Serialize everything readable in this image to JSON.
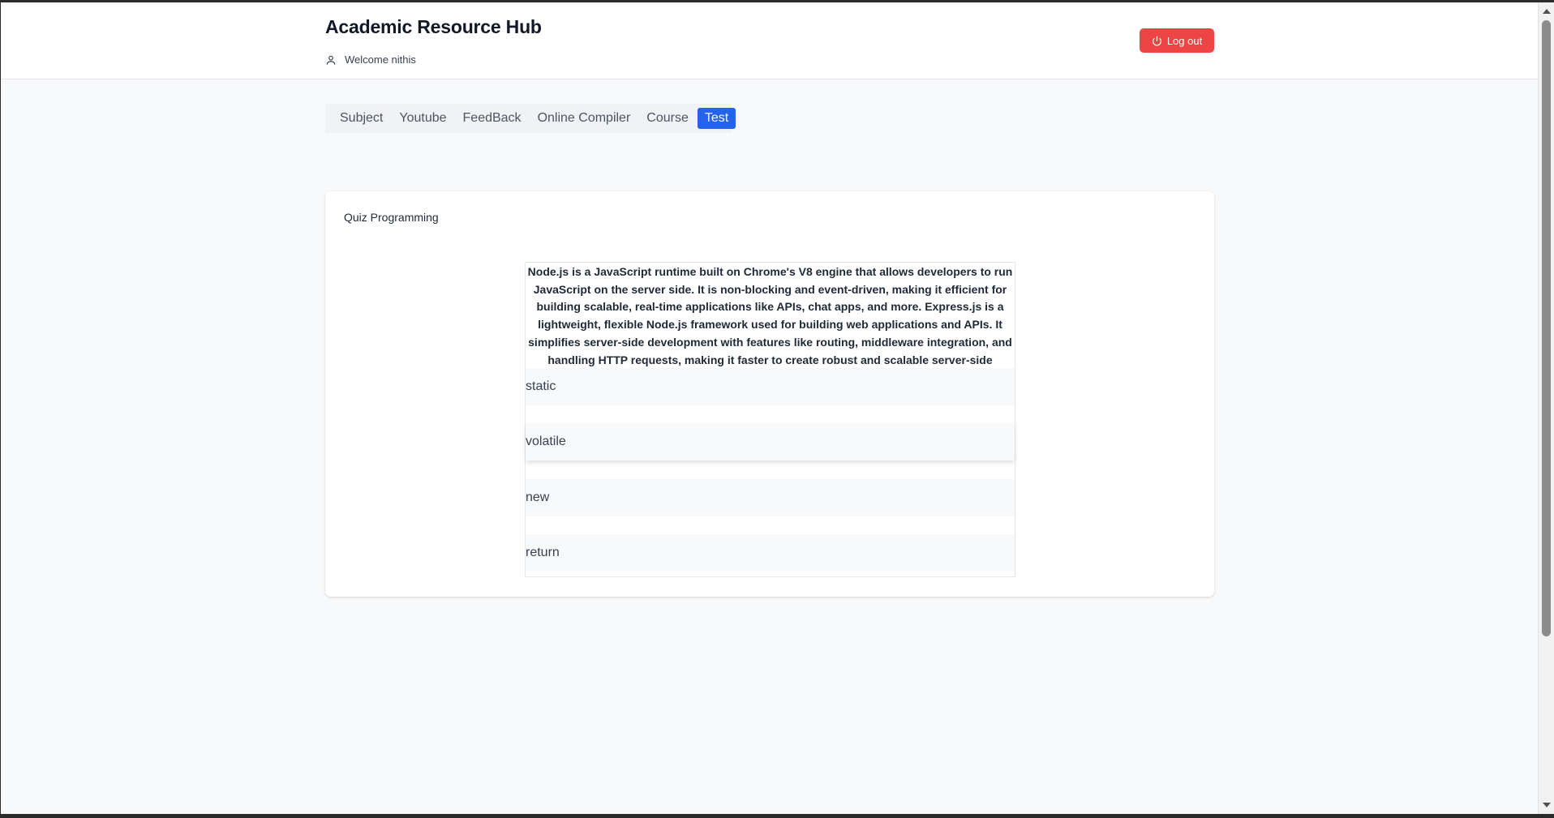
{
  "header": {
    "title": "Academic Resource Hub",
    "welcome": "Welcome nithis",
    "logout_label": "Log out"
  },
  "tabs": [
    {
      "label": "Subject"
    },
    {
      "label": "Youtube"
    },
    {
      "label": "FeedBack"
    },
    {
      "label": "Online Compiler"
    },
    {
      "label": "Course"
    },
    {
      "label": "Test",
      "active": true
    }
  ],
  "quiz": {
    "title": "Quiz Programming",
    "question": "Node.js is a JavaScript runtime built on Chrome's V8 engine that allows developers to run JavaScript on the server side. It is non-blocking and event-driven, making it efficient for building scalable, real-time applications like APIs, chat apps, and more. Express.js is a lightweight, flexible Node.js framework used for building web applications and APIs. It simplifies server-side development with features like routing, middleware integration, and handling HTTP requests, making it faster to create robust and scalable server-side solutions.",
    "options": [
      "static",
      "volatile",
      "new",
      "return"
    ]
  },
  "colors": {
    "accent": "#2563eb",
    "logout": "#ef4444",
    "background": "#f8f9fa"
  }
}
